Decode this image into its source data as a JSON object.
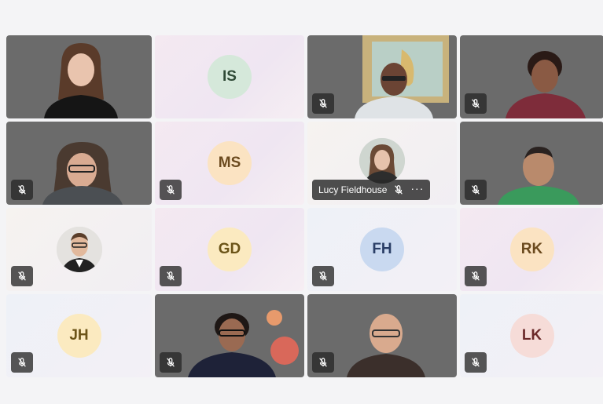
{
  "colors": {
    "avatar_green": "#d5e8da",
    "avatar_peach": "#fbe3c2",
    "avatar_yellow": "#fbeac0",
    "avatar_blue": "#c9d9f0",
    "avatar_rose": "#f6dcd8",
    "mute_badge_bg": "#303030"
  },
  "participants": [
    {
      "initials": "",
      "muted": false,
      "video": true
    },
    {
      "initials": "IS",
      "muted": false,
      "video": false
    },
    {
      "initials": "",
      "muted": true,
      "video": true
    },
    {
      "initials": "",
      "muted": true,
      "video": true
    },
    {
      "initials": "",
      "muted": true,
      "video": true
    },
    {
      "initials": "MS",
      "muted": true,
      "video": false
    },
    {
      "initials": "",
      "name": "Lucy Fieldhouse",
      "muted": true,
      "video": false,
      "photo_avatar": true,
      "more_options": "···"
    },
    {
      "initials": "",
      "muted": true,
      "video": true
    },
    {
      "initials": "",
      "muted": true,
      "video": false,
      "photo_avatar": true
    },
    {
      "initials": "GD",
      "muted": true,
      "video": false
    },
    {
      "initials": "FH",
      "muted": true,
      "video": false
    },
    {
      "initials": "RK",
      "muted": true,
      "video": false
    },
    {
      "initials": "JH",
      "muted": true,
      "video": false
    },
    {
      "initials": "",
      "muted": true,
      "video": true
    },
    {
      "initials": "",
      "muted": true,
      "video": true
    },
    {
      "initials": "LK",
      "muted": true,
      "video": false
    }
  ]
}
